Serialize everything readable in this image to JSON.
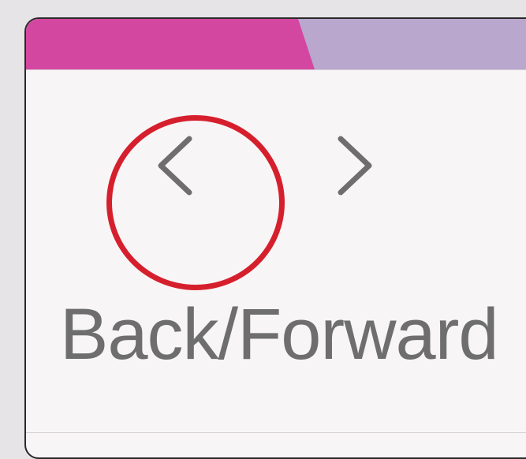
{
  "toolbar": {
    "back_icon_name": "chevron-left-icon",
    "forward_icon_name": "chevron-right-icon",
    "label": "Back/Forward"
  },
  "colors": {
    "active_tab": "#d447a0",
    "inactive_tab": "#b9a7cd",
    "content_bg": "#f8f5f7",
    "highlight": "#d61f2d",
    "icon": "#6e6e6f"
  }
}
